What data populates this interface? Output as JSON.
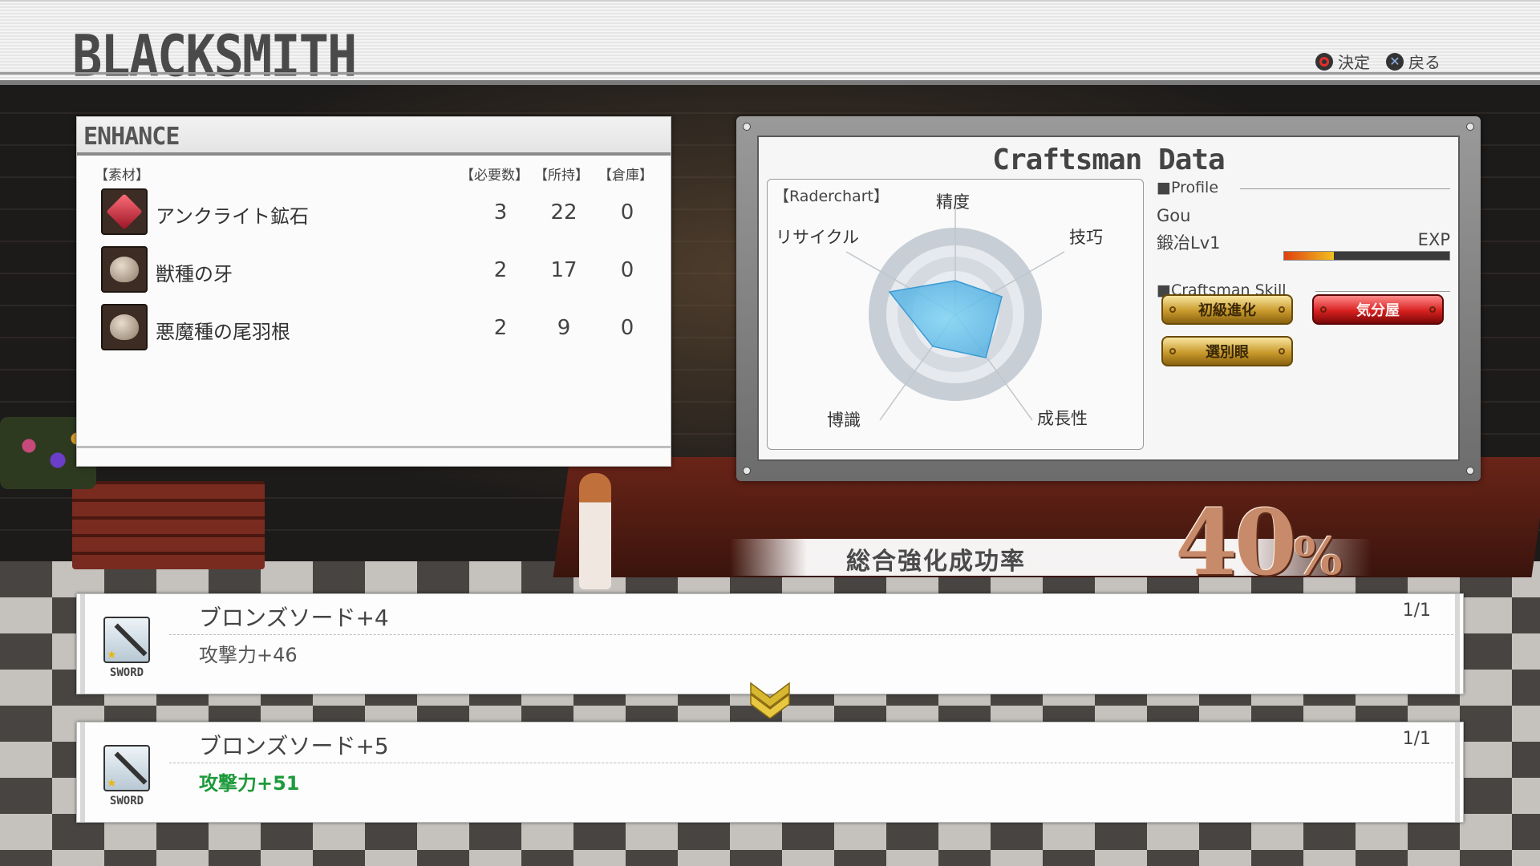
{
  "header": {
    "title": "BLACKSMITH",
    "hint_confirm": "決定",
    "hint_back": "戻る"
  },
  "enhance": {
    "title": "ENHANCE",
    "col_material": "【素材】",
    "col_required": "【必要数】",
    "col_owned": "【所持】",
    "col_storage": "【倉庫】",
    "materials": [
      {
        "name": "アンクライト鉱石",
        "required": "3",
        "owned": "22",
        "storage": "0",
        "icon": "crystal-icon"
      },
      {
        "name": "獣種の牙",
        "required": "2",
        "owned": "17",
        "storage": "0",
        "icon": "sack-icon"
      },
      {
        "name": "悪魔種の尾羽根",
        "required": "2",
        "owned": "9",
        "storage": "0",
        "icon": "sack-icon"
      }
    ]
  },
  "craftsman": {
    "title": "Craftsman Data",
    "radar_title": "【Raderchart】",
    "axes": [
      "精度",
      "技巧",
      "成長性",
      "博識",
      "リサイクル"
    ],
    "profile_header": "■Profile",
    "name": "Gou",
    "level": "鍛冶Lv1",
    "exp_label": "EXP",
    "exp_fraction": 0.3,
    "skill_header": "■Craftsman Skill",
    "skills": [
      "初級進化",
      "気分屋",
      "選別眼"
    ]
  },
  "success": {
    "label": "総合強化成功率",
    "value": "40",
    "unit": "%"
  },
  "items": [
    {
      "name": "ブロンズソード+4",
      "qty": "1/1",
      "stat": "攻撃力+46",
      "type": "SWORD"
    },
    {
      "name": "ブロンズソード+5",
      "qty": "1/1",
      "stat": "攻撃力+51",
      "type": "SWORD"
    }
  ],
  "colors": {
    "stat_up": "#1e9a3c",
    "accent_red": "#d82020",
    "accent_gold": "#c99a2c"
  }
}
